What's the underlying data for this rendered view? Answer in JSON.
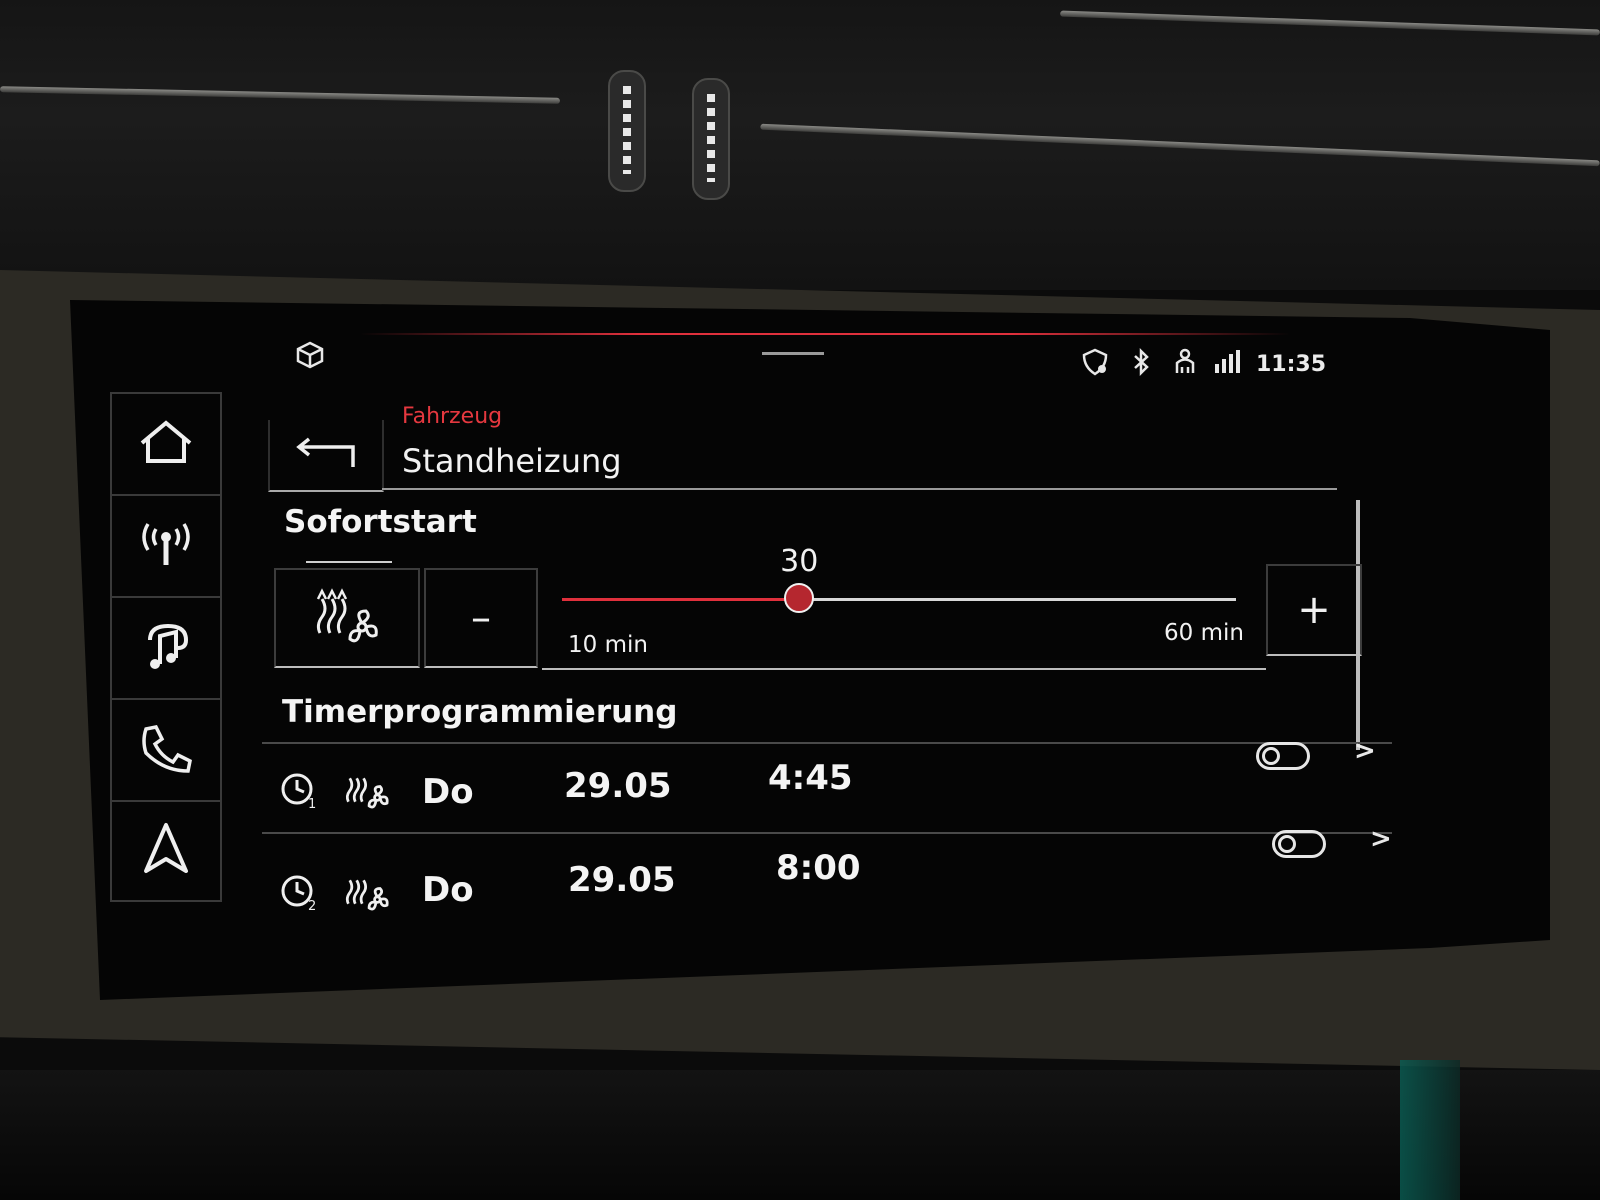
{
  "status_bar": {
    "time": "11:35",
    "icons": [
      "3d-box-icon",
      "security-shield-icon",
      "bluetooth-icon",
      "passenger-icon",
      "signal-data-icon"
    ]
  },
  "sidebar": {
    "items": [
      {
        "icon": "home-icon"
      },
      {
        "icon": "radio-icon"
      },
      {
        "icon": "media-icon"
      },
      {
        "icon": "phone-icon"
      },
      {
        "icon": "navigation-icon"
      }
    ]
  },
  "header": {
    "breadcrumb": "Fahrzeug",
    "title": "Standheizung"
  },
  "sofortstart": {
    "title": "Sofortstart",
    "mode_icon": "heat-fan-icon",
    "minus_label": "–",
    "plus_label": "+",
    "duration": {
      "value": 30,
      "min": 10,
      "max": 60,
      "min_label": "10 min",
      "max_label": "60 min"
    }
  },
  "timer": {
    "title": "Timerprogrammierung",
    "rows": [
      {
        "timer_icon": "timer-1-icon",
        "mode_icon": "heat-fan-icon",
        "day": "Do",
        "date": "29.05",
        "time": "4:45",
        "enabled": false
      },
      {
        "timer_icon": "timer-2-icon",
        "mode_icon": "heat-fan-icon",
        "day": "Do",
        "date": "29.05",
        "time": "8:00",
        "enabled": false
      }
    ]
  },
  "colors": {
    "accent_red": "#e0303c",
    "background": "#050505",
    "text": "#f2f2f2"
  }
}
